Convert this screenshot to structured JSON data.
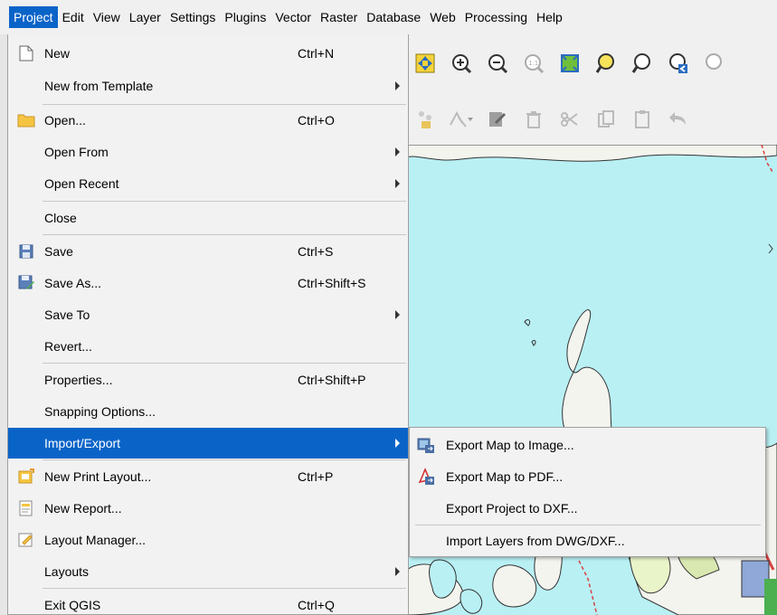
{
  "menubar": {
    "items": [
      "Project",
      "Edit",
      "View",
      "Layer",
      "Settings",
      "Plugins",
      "Vector",
      "Raster",
      "Database",
      "Web",
      "Processing",
      "Help"
    ]
  },
  "project_menu": {
    "items": [
      {
        "label": "New",
        "shortcut": "Ctrl+N",
        "icon": "new-document-icon"
      },
      {
        "label": "New from Template",
        "shortcut": "",
        "submenu": true
      },
      {
        "label": "Open...",
        "shortcut": "Ctrl+O",
        "icon": "folder-icon"
      },
      {
        "label": "Open From",
        "shortcut": "",
        "submenu": true
      },
      {
        "label": "Open Recent",
        "shortcut": "",
        "submenu": true
      },
      {
        "label": "Close",
        "shortcut": ""
      },
      {
        "label": "Save",
        "shortcut": "Ctrl+S",
        "icon": "save-icon"
      },
      {
        "label": "Save As...",
        "shortcut": "Ctrl+Shift+S",
        "icon": "save-as-icon"
      },
      {
        "label": "Save To",
        "shortcut": "",
        "submenu": true
      },
      {
        "label": "Revert...",
        "shortcut": ""
      },
      {
        "label": "Properties...",
        "shortcut": "Ctrl+Shift+P"
      },
      {
        "label": "Snapping Options...",
        "shortcut": ""
      },
      {
        "label": "Import/Export",
        "shortcut": "",
        "submenu": true,
        "highlighted": true
      },
      {
        "label": "New Print Layout...",
        "shortcut": "Ctrl+P",
        "icon": "print-layout-icon"
      },
      {
        "label": "New Report...",
        "shortcut": "",
        "icon": "report-icon"
      },
      {
        "label": "Layout Manager...",
        "shortcut": "",
        "icon": "layout-manager-icon"
      },
      {
        "label": "Layouts",
        "shortcut": "",
        "submenu": true
      },
      {
        "label": "Exit QGIS",
        "shortcut": "Ctrl+Q"
      }
    ]
  },
  "import_export_menu": {
    "items": [
      {
        "label": "Export Map to Image...",
        "icon": "export-image-icon"
      },
      {
        "label": "Export Map to PDF...",
        "icon": "pdf-icon"
      },
      {
        "label": "Export Project to DXF..."
      },
      {
        "label": "Import Layers from DWG/DXF..."
      }
    ]
  },
  "colors": {
    "highlight": "#0a64c8",
    "map_water": "#b9f0f4",
    "menu_bg": "#f2f2f2"
  }
}
